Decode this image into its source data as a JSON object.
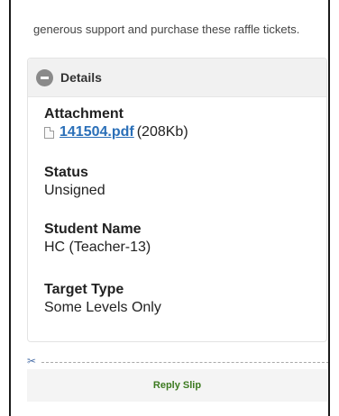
{
  "intro_text": "generous support and purchase these raffle tickets.",
  "details": {
    "title": "Details",
    "collapse_icon": "minus-circle-icon",
    "attachment": {
      "label": "Attachment",
      "file_icon": "file-icon",
      "file_name": "141504.pdf",
      "file_size": "(208Kb)"
    },
    "status": {
      "label": "Status",
      "value": "Unsigned"
    },
    "student_name": {
      "label": "Student Name",
      "value": "HC (Teacher-13)"
    },
    "target_type": {
      "label": "Target Type",
      "value": "Some Levels Only"
    }
  },
  "reply_slip": {
    "scissors_icon": "scissors-icon",
    "label": "Reply Slip"
  },
  "colors": {
    "link": "#2a6fb8",
    "reply_label": "#3c7a20",
    "header_bg": "#f1f1f1"
  }
}
